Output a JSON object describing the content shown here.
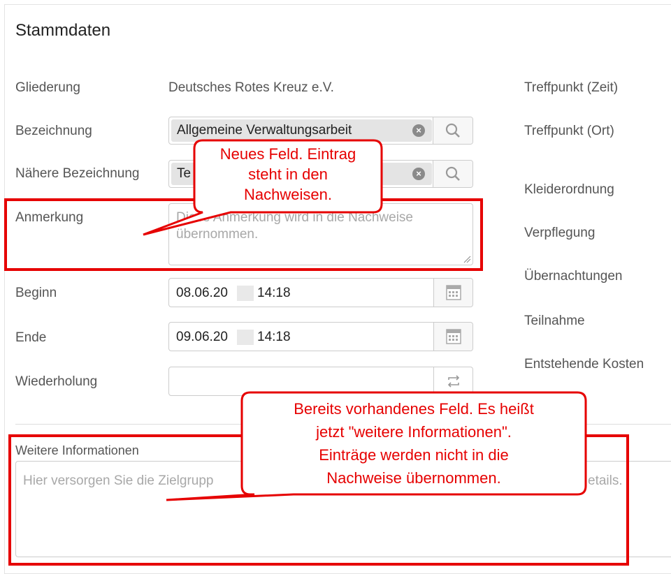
{
  "section_title": "Stammdaten",
  "fields": {
    "gliederung": {
      "label": "Gliederung",
      "value": "Deutsches Rotes Kreuz e.V."
    },
    "bezeichnung": {
      "label": "Bezeichnung",
      "value": "Allgemeine Verwaltungsarbeit"
    },
    "naehere": {
      "label": "Nähere Bezeichnung",
      "value": "Te"
    },
    "anmerkung": {
      "label": "Anmerkung",
      "placeholder_line1": "Diese Anmerkung wird in die Nachweise",
      "placeholder_line2": "übernommen."
    },
    "beginn": {
      "label": "Beginn",
      "date_part": "08.06.20",
      "time_part": "14:18"
    },
    "ende": {
      "label": "Ende",
      "date_part": "09.06.20",
      "time_part": "14:18"
    },
    "wiederholung": {
      "label": "Wiederholung",
      "value": ""
    },
    "weitere": {
      "label": "Weitere Informationen",
      "placeholder_left": "Hier versorgen Sie die Zielgrupp",
      "placeholder_right": "etails."
    }
  },
  "right_labels": [
    "Treffpunkt (Zeit)",
    "Treffpunkt (Ort)",
    "Kleiderordnung",
    "Verpflegung",
    "Übernachtungen",
    "Teilnahme",
    "Entstehende Kosten"
  ],
  "callouts": {
    "neu": [
      "Neues Feld. Eintrag",
      "steht in den",
      "Nachweisen."
    ],
    "bereits": [
      "Bereits vorhandenes Feld. Es heißt",
      "jetzt \"weitere Informationen\".",
      "Einträge werden nicht in die",
      "Nachweise übernommen."
    ]
  },
  "icons": {
    "search": "magnifier-icon",
    "clear": "clear-x-icon",
    "calendar": "calendar-icon",
    "repeat": "repeat-icon"
  },
  "colors": {
    "annotation_red": "#e60000",
    "chip_gray": "#e4e4e4",
    "border": "#cccccc"
  }
}
